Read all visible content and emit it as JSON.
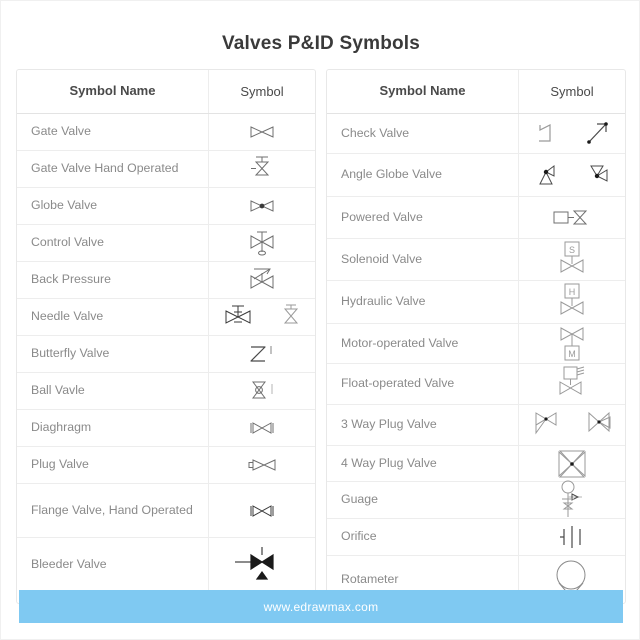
{
  "page": {
    "title": "Valves P&ID Symbols",
    "background_color": "#ffffff"
  },
  "footer": {
    "url": "www.edrawmax.com",
    "background_color": "#7FC9F2",
    "text_color": "#ffffff"
  },
  "tables": {
    "headers": {
      "name": "Symbol Name",
      "symbol": "Symbol"
    },
    "left": {
      "rows": [
        {
          "name": "Gate Valve",
          "symbol_icons": [
            "gate-valve-icon"
          ]
        },
        {
          "name": "Gate Valve Hand Operated",
          "symbol_icons": [
            "gate-valve-hand-operated-icon"
          ]
        },
        {
          "name": "Globe Valve",
          "symbol_icons": [
            "globe-valve-icon"
          ]
        },
        {
          "name": "Control Valve",
          "symbol_icons": [
            "control-valve-icon"
          ]
        },
        {
          "name": "Back Pressure",
          "symbol_icons": [
            "back-pressure-valve-icon"
          ]
        },
        {
          "name": "Needle Valve",
          "symbol_icons": [
            "needle-valve-icon",
            "needle-valve-alt-icon"
          ]
        },
        {
          "name": "Butterfly Valve",
          "symbol_icons": [
            "butterfly-valve-icon"
          ]
        },
        {
          "name": "Ball Vavle",
          "symbol_icons": [
            "ball-valve-icon"
          ]
        },
        {
          "name": "Diaghragm",
          "symbol_icons": [
            "diaphragm-valve-icon"
          ]
        },
        {
          "name": "Plug Valve",
          "symbol_icons": [
            "plug-valve-icon"
          ]
        },
        {
          "name": "Flange Valve, Hand Operated",
          "symbol_icons": [
            "flange-valve-hand-operated-icon"
          ]
        },
        {
          "name": "Bleeder Valve",
          "symbol_icons": [
            "bleeder-valve-icon"
          ]
        }
      ]
    },
    "right": {
      "rows": [
        {
          "name": "Check Valve",
          "symbol_icons": [
            "check-valve-icon",
            "check-valve-alt-icon"
          ]
        },
        {
          "name": "Angle Globe Valve",
          "symbol_icons": [
            "angle-globe-valve-icon",
            "angle-globe-valve-alt-icon"
          ]
        },
        {
          "name": "Powered Valve",
          "symbol_icons": [
            "powered-valve-icon"
          ]
        },
        {
          "name": "Solenoid Valve",
          "symbol_icons": [
            "solenoid-valve-icon"
          ],
          "label": "S"
        },
        {
          "name": "Hydraulic Valve",
          "symbol_icons": [
            "hydraulic-valve-icon"
          ],
          "label": "H"
        },
        {
          "name": "Motor-operated Valve",
          "symbol_icons": [
            "motor-operated-valve-icon"
          ],
          "label": "M"
        },
        {
          "name": "Float-operated Valve",
          "symbol_icons": [
            "float-operated-valve-icon"
          ]
        },
        {
          "name": "3 Way Plug Valve",
          "symbol_icons": [
            "three-way-plug-valve-icon",
            "three-way-plug-valve-alt-icon"
          ]
        },
        {
          "name": "4 Way Plug Valve",
          "symbol_icons": [
            "four-way-plug-valve-icon"
          ]
        },
        {
          "name": "Guage",
          "symbol_icons": [
            "gauge-icon"
          ]
        },
        {
          "name": "Orifice",
          "symbol_icons": [
            "orifice-icon"
          ]
        },
        {
          "name": "Rotameter",
          "symbol_icons": [
            "rotameter-icon"
          ]
        }
      ]
    }
  },
  "colors": {
    "stroke": "#6f6f6f",
    "text": "#8a8a8a",
    "heading": "#3a3a3a",
    "border": "#ededed"
  }
}
